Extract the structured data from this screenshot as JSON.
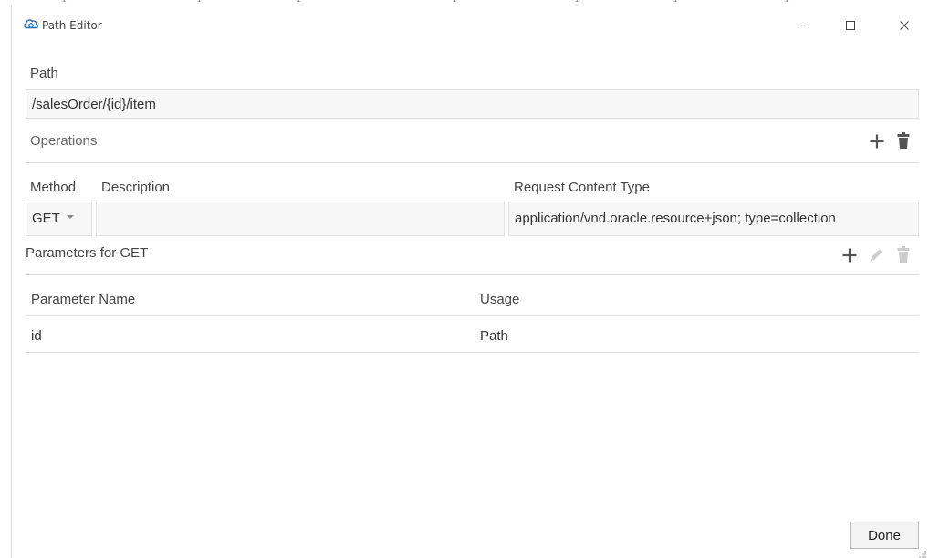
{
  "window": {
    "title": "Path Editor",
    "icons": {
      "app": "cloud-gear-icon",
      "minimize": "minimize-icon",
      "maximize": "maximize-icon",
      "close": "close-icon"
    }
  },
  "path": {
    "label": "Path",
    "value": "/salesOrder/{id}/item"
  },
  "operations": {
    "label": "Operations",
    "icons": [
      "add-icon",
      "delete-icon"
    ],
    "columns": {
      "method": "Method",
      "description": "Description",
      "content_type": "Request Content Type"
    },
    "rows": [
      {
        "method": "GET",
        "description": "",
        "content_type": "application/vnd.oracle.resource+json; type=collection"
      }
    ]
  },
  "parameters": {
    "label": "Parameters for GET",
    "icons": [
      "add-icon",
      "edit-icon",
      "delete-icon"
    ],
    "columns": {
      "name": "Parameter Name",
      "usage": "Usage"
    },
    "rows": [
      {
        "name": "id",
        "usage": "Path"
      }
    ]
  },
  "footer": {
    "done_label": "Done"
  },
  "colors": {
    "active_icon": "#555555",
    "disabled_icon": "#cccccc",
    "field_background": "#f7f7f7",
    "divider": "#dcdcdc"
  }
}
